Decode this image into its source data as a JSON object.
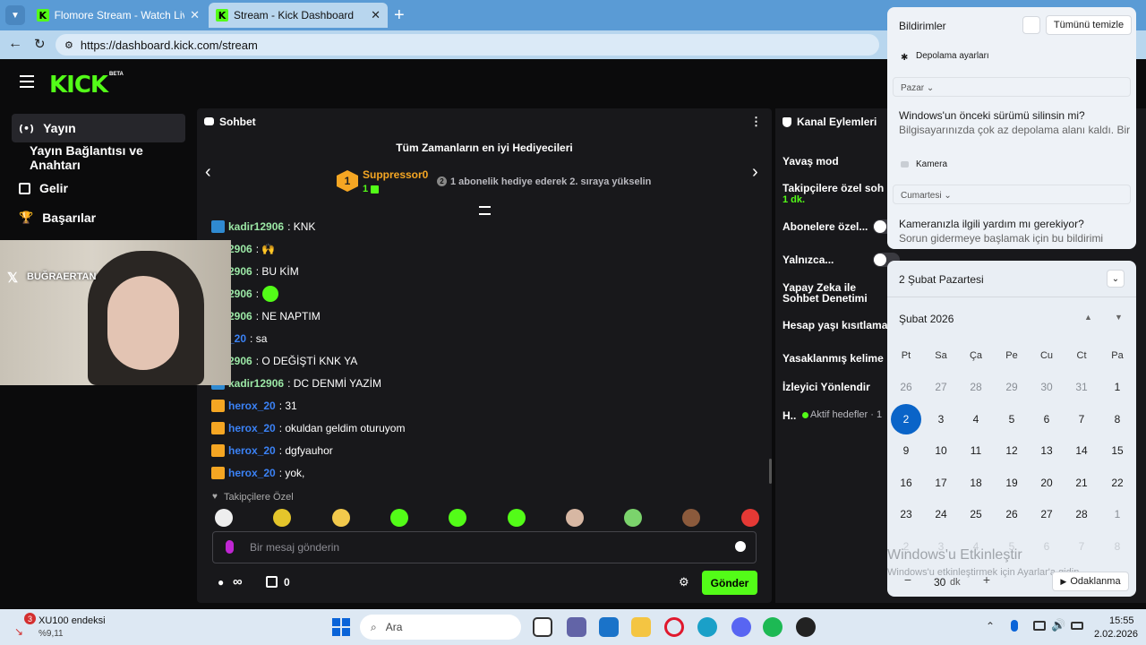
{
  "browser": {
    "tabs": [
      {
        "title": "Flomore Stream - Watch Live on Ki",
        "active": false
      },
      {
        "title": "Stream - Kick Dashboard",
        "active": true
      }
    ],
    "url": "https://dashboard.kick.com/stream"
  },
  "kick": {
    "logo": "KICK",
    "logo_badge": "BETA",
    "sidebar": [
      {
        "label": "Yayın",
        "icon": "broadcast-icon",
        "active": true
      },
      {
        "label": "Yayın Bağlantısı ve Anahtarı",
        "icon": ""
      },
      {
        "label": "Gelir",
        "icon": "chart-icon"
      },
      {
        "label": "Başarılar",
        "icon": "trophy-icon"
      }
    ],
    "webcam_label": "BUĞRAERTAN"
  },
  "chat": {
    "title": "Sohbet",
    "gifters_title": "Tüm Zamanların en iyi Hediyecileri",
    "top_gifter": {
      "rank": "1",
      "name": "Suppressor0",
      "count": "1"
    },
    "rank2_hint_num": "2",
    "rank2_hint": "1 abonelik hediye ederek 2. sıraya yükselin",
    "messages": [
      {
        "user": "kadir12906",
        "text": "KNK",
        "badge": "blue"
      },
      {
        "user": "2906",
        "text": "🙌",
        "badge": "blue"
      },
      {
        "user": "2906",
        "text": "BU KİM",
        "badge": "blue"
      },
      {
        "user": "2906",
        "text": "",
        "badge": "blue",
        "emote": true
      },
      {
        "user": "2906",
        "text": "NE NAPTIM",
        "badge": "blue"
      },
      {
        "user": "_20",
        "text": "sa",
        "badge": "crown",
        "blueuser": true
      },
      {
        "user": "2906",
        "text": "O DEĞİŞTİ KNK YA",
        "badge": "blue"
      },
      {
        "user": "kadir12906",
        "text": "DC DENMİ YAZİM",
        "badge": "blue"
      },
      {
        "user": "herox_20",
        "text": "31",
        "badge": "crown",
        "blueuser": true
      },
      {
        "user": "herox_20",
        "text": "okuldan geldim oturuyom",
        "badge": "crown",
        "blueuser": true
      },
      {
        "user": "herox_20",
        "text": "dgfyauhor",
        "badge": "crown",
        "blueuser": true
      },
      {
        "user": "herox_20",
        "text": "yok,",
        "badge": "crown",
        "blueuser": true
      }
    ],
    "followers_only_label": "Takipçilere Özel",
    "input_placeholder": "Bir mesaj gönderin",
    "points_label": "∞",
    "store_count": "0",
    "send_label": "Gönder"
  },
  "channel_actions": {
    "title": "Kanal Eylemleri",
    "items": [
      {
        "label": "Yavaş mod"
      },
      {
        "label": "Takipçilere özel soh",
        "sub": "1 dk."
      },
      {
        "label": "Abonelere özel..."
      },
      {
        "label": "Yalnızca..."
      },
      {
        "label": "Yapay Zeka ile\nSohbet Denetimi"
      },
      {
        "label": "Hesap yaşı kısıtlama"
      },
      {
        "label": "Yasaklanmış kelime"
      },
      {
        "label": "İzleyici Yönlendir"
      },
      {
        "label": "H..",
        "sub": "Aktif hedefler · 1"
      }
    ]
  },
  "notifications": {
    "title": "Bildirimler",
    "clear_all": "Tümünü temizle",
    "storage": "Depolama ayarları",
    "group1": "Pazar",
    "n1_title": "Windows'un önceki sürümü silinsin mi?",
    "n1_body": "Bilgisayarınızda çok az depolama alanı kaldı. Bir",
    "camera": "Kamera",
    "group2": "Cumartesi",
    "n2_title": "Kameranızla ilgili yardım mı gerekiyor?",
    "n2_body": "Sorun gidermeye başlamak için bu bildirimi"
  },
  "calendar": {
    "date_header": "2 Şubat Pazartesi",
    "month": "Şubat 2026",
    "weekdays": [
      "Pt",
      "Sa",
      "Ça",
      "Pe",
      "Cu",
      "Ct",
      "Pa"
    ],
    "weeks": [
      [
        "26",
        "27",
        "28",
        "29",
        "30",
        "31",
        "1"
      ],
      [
        "2",
        "3",
        "4",
        "5",
        "6",
        "7",
        "8"
      ],
      [
        "9",
        "10",
        "11",
        "12",
        "13",
        "14",
        "15"
      ],
      [
        "16",
        "17",
        "18",
        "19",
        "20",
        "21",
        "22"
      ],
      [
        "23",
        "24",
        "25",
        "26",
        "27",
        "28",
        "1"
      ],
      [
        "2",
        "3",
        "4",
        "5",
        "6",
        "7",
        "8"
      ]
    ],
    "today": "2",
    "focus_minutes": "30",
    "focus_unit": "dk",
    "focus_label": "Odaklanma",
    "watermark_title": "Windows'u Etkinleştir",
    "watermark_body": "Windows'u etkinleştirmek için Ayarlar'a gidin."
  },
  "taskbar": {
    "stock_name": "XU100 endeksi",
    "stock_change": "%9,11",
    "stock_badge": "3",
    "search_placeholder": "Ara",
    "time": "15:55",
    "date": "2.02.2026"
  }
}
